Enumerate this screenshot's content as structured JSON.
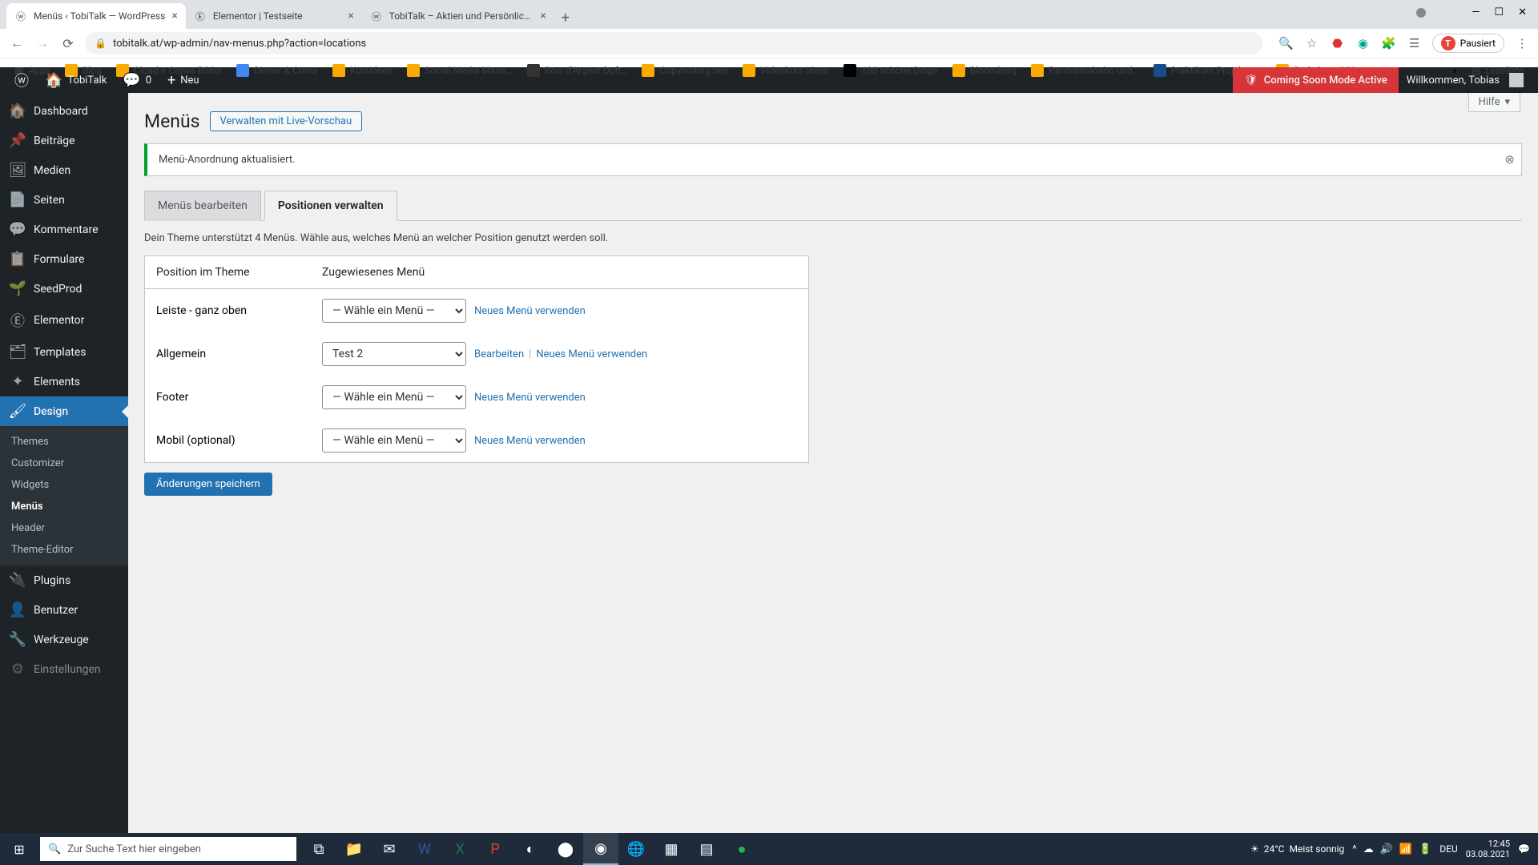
{
  "browser": {
    "tabs": [
      {
        "title": "Menüs ‹ TobiTalk — WordPress",
        "active": true
      },
      {
        "title": "Elementor | Testseite",
        "active": false
      },
      {
        "title": "TobiTalk – Aktien und Persönlich…",
        "active": false
      }
    ],
    "url": "tobitalk.at/wp-admin/nav-menus.php?action=locations",
    "paused_label": "Pausiert",
    "bookmarks": [
      "Apps",
      "Blog",
      "Cload + Canva Bilder",
      "Dinner & Crime",
      "Kursideen",
      "Social Media Mana…",
      "Bois d'Argent Duft…",
      "Copywriting neu",
      "Videokurs Ideen",
      "180 schöne Dinge",
      "Bloomberg",
      "Panoramabahn und…",
      "Praktikum Projektm…",
      "Praktikum WU"
    ],
    "reading_list": "Leseliste"
  },
  "adminbar": {
    "site": "TobiTalk",
    "comments": "0",
    "new": "Neu",
    "coming_soon": "Coming Soon Mode Active",
    "welcome": "Willkommen, Tobias"
  },
  "sidebar": {
    "items": [
      {
        "icon": "🏠",
        "label": "Dashboard"
      },
      {
        "icon": "📌",
        "label": "Beiträge"
      },
      {
        "icon": "🖼",
        "label": "Medien"
      },
      {
        "icon": "📄",
        "label": "Seiten"
      },
      {
        "icon": "💬",
        "label": "Kommentare"
      },
      {
        "icon": "📋",
        "label": "Formulare"
      },
      {
        "icon": "🌱",
        "label": "SeedProd"
      },
      {
        "icon": "Ⓔ",
        "label": "Elementor"
      },
      {
        "icon": "🗂",
        "label": "Templates"
      },
      {
        "icon": "✦",
        "label": "Elements"
      },
      {
        "icon": "🖌",
        "label": "Design"
      },
      {
        "icon": "🔌",
        "label": "Plugins"
      },
      {
        "icon": "👤",
        "label": "Benutzer"
      },
      {
        "icon": "🔧",
        "label": "Werkzeuge"
      },
      {
        "icon": "⚙",
        "label": "Einstellungen"
      }
    ],
    "submenu": [
      "Themes",
      "Customizer",
      "Widgets",
      "Menüs",
      "Header",
      "Theme-Editor"
    ]
  },
  "content": {
    "help": "Hilfe",
    "title": "Menüs",
    "live_preview_btn": "Verwalten mit Live-Vorschau",
    "notice": "Menü-Anordnung aktualisiert.",
    "tabs": {
      "edit": "Menüs bearbeiten",
      "locations": "Positionen verwalten"
    },
    "description": "Dein Theme unterstützt 4 Menüs. Wähle aus, welches Menü an welcher Position genutzt werden soll.",
    "table": {
      "th_position": "Position im Theme",
      "th_assigned": "Zugewiesenes Menü",
      "placeholder": "— Wähle ein Menü —",
      "rows": [
        {
          "label": "Leiste - ganz oben",
          "value": "— Wähle ein Menü —",
          "actions": [
            "Neues Menü verwenden"
          ]
        },
        {
          "label": "Allgemein",
          "value": "Test 2",
          "actions": [
            "Bearbeiten",
            "Neues Menü verwenden"
          ]
        },
        {
          "label": "Footer",
          "value": "— Wähle ein Menü —",
          "actions": [
            "Neues Menü verwenden"
          ]
        },
        {
          "label": "Mobil (optional)",
          "value": "— Wähle ein Menü —",
          "actions": [
            "Neues Menü verwenden"
          ]
        }
      ]
    },
    "save_btn": "Änderungen speichern"
  },
  "taskbar": {
    "search_placeholder": "Zur Suche Text hier eingeben",
    "weather_temp": "24°C",
    "weather_text": "Meist sonnig",
    "lang": "DEU",
    "time": "12:45",
    "date": "03.08.2021"
  }
}
